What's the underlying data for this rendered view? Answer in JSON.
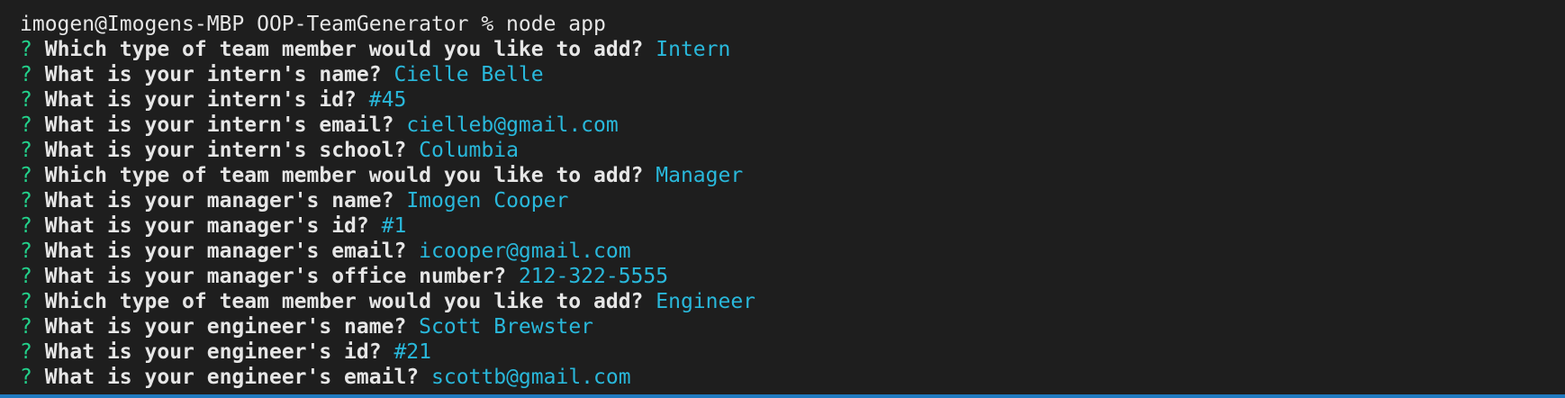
{
  "terminal": {
    "prompt_line": "imogen@Imogens-MBP OOP-TeamGenerator % node app",
    "prompt_mark": "?",
    "lines": [
      {
        "question": "Which type of team member would you like to add?",
        "answer": "Intern"
      },
      {
        "question": "What is your intern's name?",
        "answer": "Cielle Belle"
      },
      {
        "question": "What is your intern's id?",
        "answer": "#45"
      },
      {
        "question": "What is your intern's email?",
        "answer": "cielleb@gmail.com"
      },
      {
        "question": "What is your intern's school?",
        "answer": "Columbia"
      },
      {
        "question": "Which type of team member would you like to add?",
        "answer": "Manager"
      },
      {
        "question": "What is your manager's name?",
        "answer": "Imogen Cooper"
      },
      {
        "question": "What is your manager's id?",
        "answer": "#1"
      },
      {
        "question": "What is your manager's email?",
        "answer": "icooper@gmail.com"
      },
      {
        "question": "What is your manager's office number?",
        "answer": "212-322-5555"
      },
      {
        "question": "Which type of team member would you like to add?",
        "answer": "Engineer"
      },
      {
        "question": "What is your engineer's name?",
        "answer": "Scott Brewster"
      },
      {
        "question": "What is your engineer's id?",
        "answer": "#21"
      },
      {
        "question": "What is your engineer's email?",
        "answer": "scottb@gmail.com"
      }
    ]
  },
  "colors": {
    "background": "#1e1e1e",
    "question_mark": "#23d18b",
    "answer": "#29b8db",
    "text": "#e6e6e6",
    "border": "#1f7ac0"
  }
}
